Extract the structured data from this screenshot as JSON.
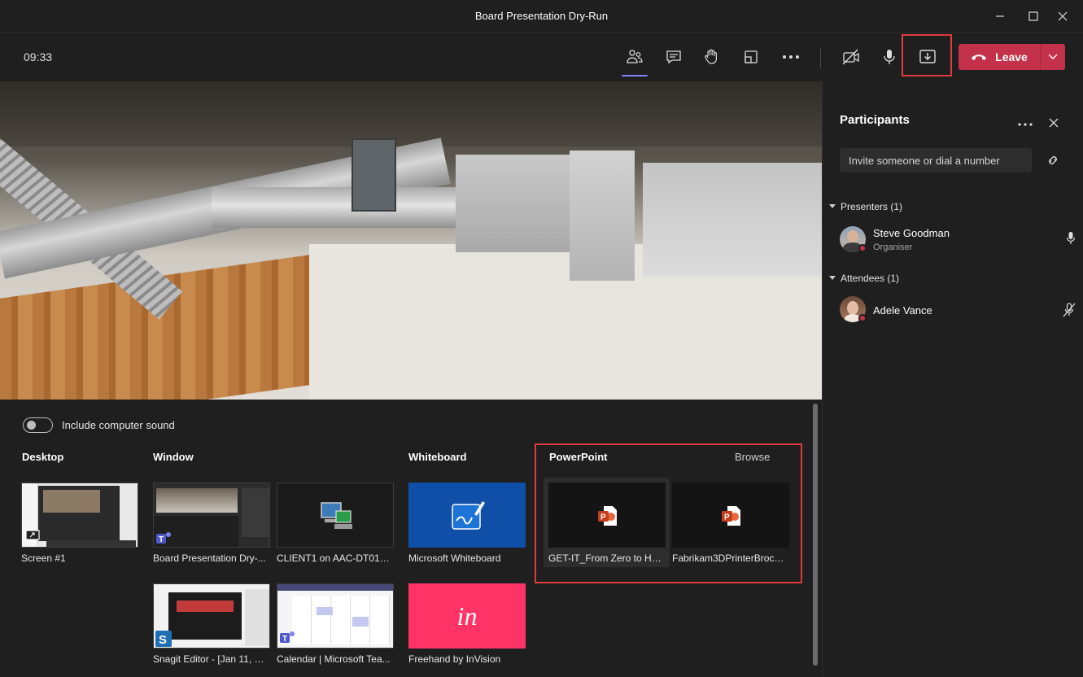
{
  "window": {
    "title": "Board Presentation Dry-Run"
  },
  "toolbar": {
    "time": "09:33",
    "leave_label": "Leave",
    "accent_color": "#c4314b"
  },
  "share": {
    "include_sound_label": "Include computer sound",
    "include_sound_on": false,
    "sections": {
      "desktop": "Desktop",
      "window": "Window",
      "whiteboard": "Whiteboard",
      "powerpoint": "PowerPoint",
      "browse": "Browse"
    },
    "desktop_tiles": [
      {
        "caption": "Screen #1"
      }
    ],
    "window_tiles": [
      {
        "caption": "Board Presentation Dry-..."
      },
      {
        "caption": "CLIENT1 on AAC-DT01 - ..."
      },
      {
        "caption": "Snagit Editor - [Jan 11, 2..."
      },
      {
        "caption": "Calendar | Microsoft Tea..."
      }
    ],
    "whiteboard_tiles": [
      {
        "caption": "Microsoft Whiteboard"
      },
      {
        "caption": "Freehand by InVision",
        "logo_text": "in"
      }
    ],
    "powerpoint_tiles": [
      {
        "caption": "GET-IT_From Zero to He...",
        "selected": true
      },
      {
        "caption": "Fabrikam3DPrinterBroch..."
      }
    ]
  },
  "participants": {
    "title": "Participants",
    "invite_placeholder": "Invite someone or dial a number",
    "presenters_label": "Presenters (1)",
    "attendees_label": "Attendees (1)",
    "presenters": [
      {
        "name": "Steve Goodman",
        "role": "Organiser",
        "mic": "on"
      }
    ],
    "attendees": [
      {
        "name": "Adele Vance",
        "mic": "muted"
      }
    ]
  }
}
